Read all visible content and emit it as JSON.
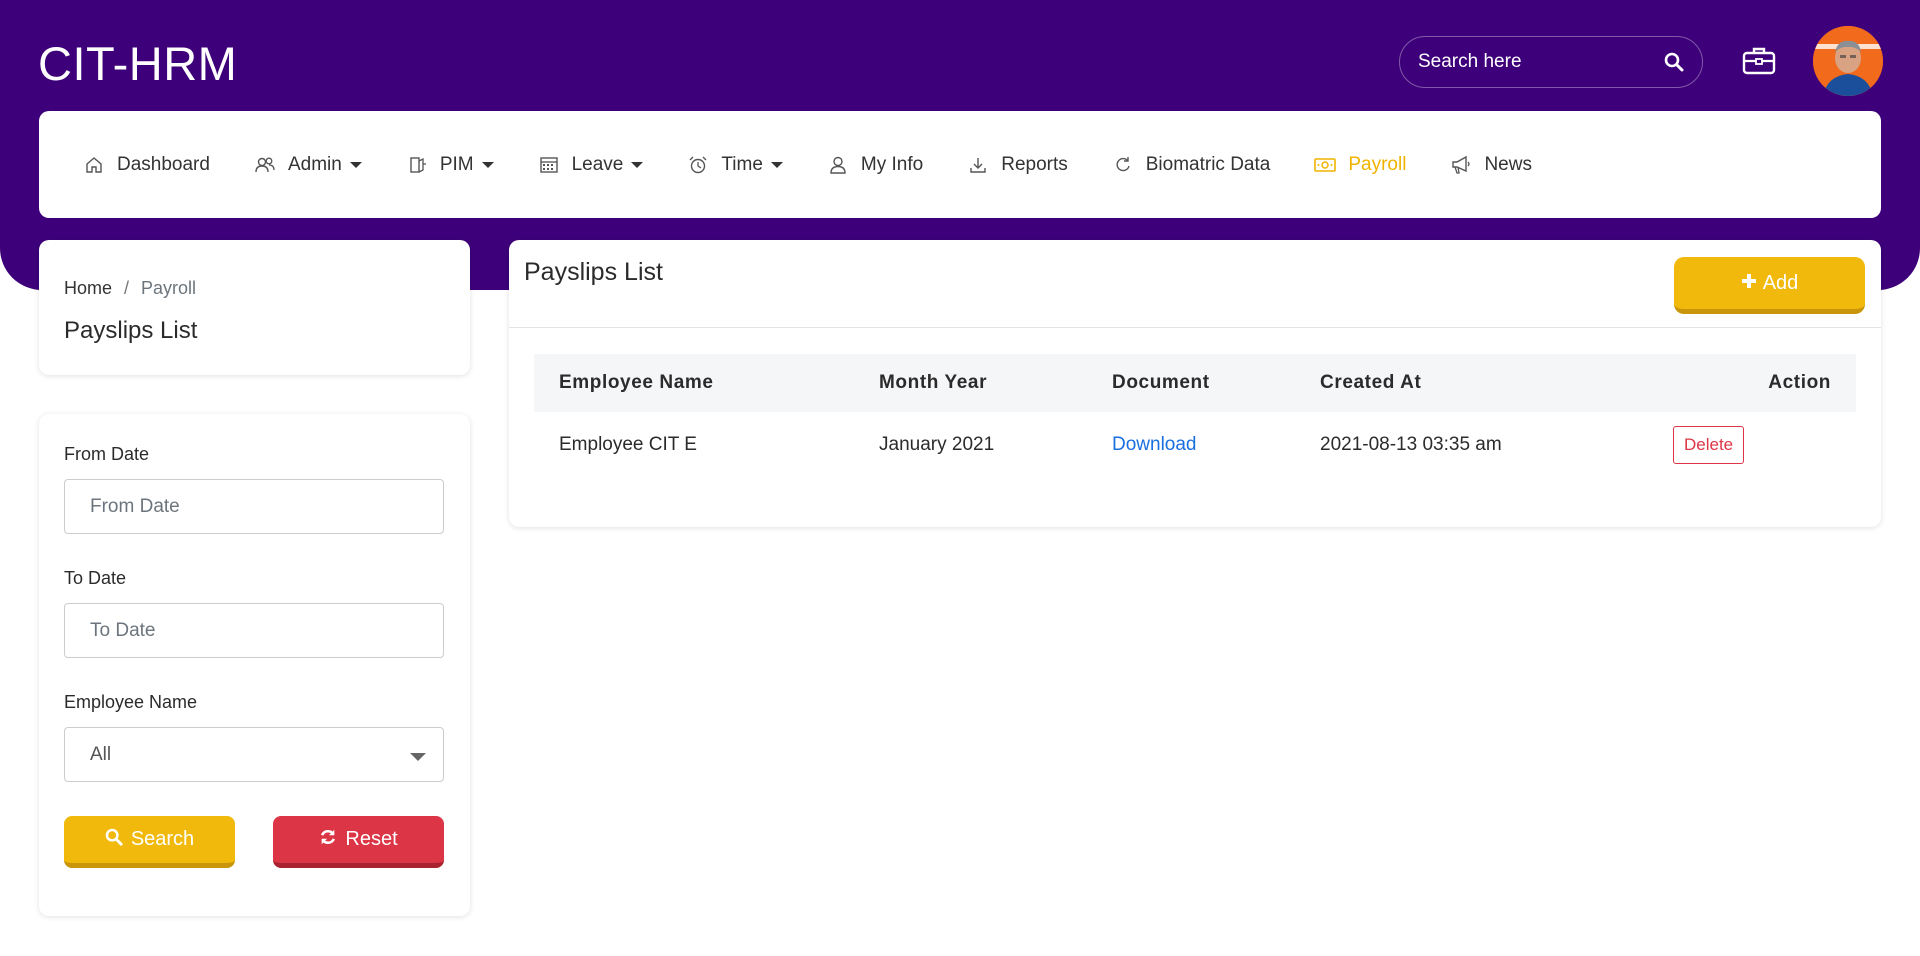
{
  "header": {
    "brand": "CIT-HRM",
    "search_placeholder": "Search here"
  },
  "nav": {
    "items": [
      {
        "label": "Dashboard",
        "icon": "home-icon"
      },
      {
        "label": "Admin",
        "icon": "users-icon",
        "dropdown": true
      },
      {
        "label": "PIM",
        "icon": "pim-icon",
        "dropdown": true
      },
      {
        "label": "Leave",
        "icon": "calendar-icon",
        "dropdown": true
      },
      {
        "label": "Time",
        "icon": "alarm-clock-icon",
        "dropdown": true
      },
      {
        "label": "My Info",
        "icon": "user-icon"
      },
      {
        "label": "Reports",
        "icon": "download-icon"
      },
      {
        "label": "Biomatric Data",
        "icon": "refresh-icon"
      },
      {
        "label": "Payroll",
        "icon": "money-icon",
        "active": true
      },
      {
        "label": "News",
        "icon": "megaphone-icon"
      }
    ],
    "active_color": "#f0b400"
  },
  "breadcrumb": {
    "home": "Home",
    "separator": "/",
    "current": "Payroll",
    "page_title": "Payslips List"
  },
  "filter": {
    "from_date_label": "From Date",
    "from_date_placeholder": "From Date",
    "to_date_label": "To Date",
    "to_date_placeholder": "To Date",
    "employee_label": "Employee Name",
    "employee_selected": "All",
    "search_label": "Search",
    "reset_label": "Reset"
  },
  "list": {
    "title": "Payslips List",
    "add_label": "Add",
    "columns": [
      "Employee Name",
      "Month Year",
      "Document",
      "Created At",
      "Action"
    ],
    "rows": [
      {
        "employee_name": "Employee CIT E",
        "month_year": "January 2021",
        "document": "Download",
        "created_at": "2021-08-13 03:35 am",
        "action": "Delete"
      }
    ]
  },
  "colors": {
    "primary": "#3d007a",
    "accent": "#f0b90b",
    "danger": "#dc3545",
    "link": "#1a6fe0"
  }
}
